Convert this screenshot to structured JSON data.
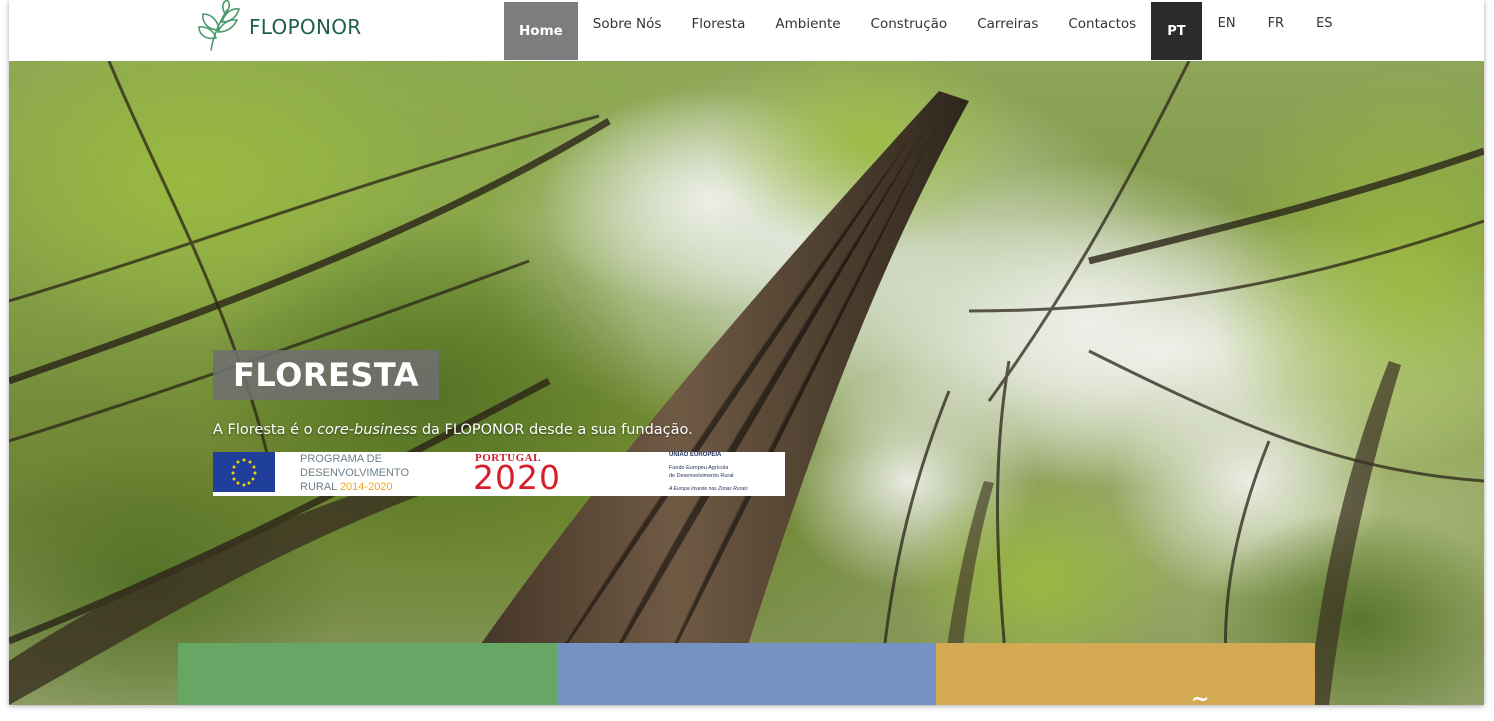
{
  "header": {
    "logo_text": "FLOPONOR",
    "nav": [
      "Home",
      "Sobre Nós",
      "Floresta",
      "Ambiente",
      "Construção",
      "Carreiras",
      "Contactos"
    ],
    "active_nav": "Home",
    "languages": [
      "PT",
      "EN",
      "FR",
      "ES"
    ],
    "active_language": "PT"
  },
  "hero": {
    "title": "FLORESTA",
    "subtitle_before": "A Floresta é o ",
    "subtitle_em": "core-business",
    "subtitle_after": " da FLOPONOR desde a sua fundação."
  },
  "funding": {
    "pdr_line1": "PROGRAMA DE",
    "pdr_line2": "DESENVOLVIMENTO",
    "pdr_line3_a": "RURAL ",
    "pdr_line3_b": "2014-2020",
    "portugal_word": "PORTUGAL",
    "portugal_year": "2020",
    "eu_title": "UNIÃO EUROPEIA",
    "eu_line1": "Fundo Europeu Agrícola",
    "eu_line2": "de Desenvolvimento Rural",
    "eu_slogan": "A Europa Investe nas Zonas Rurais"
  },
  "tiles": {
    "gold_partial": "~"
  },
  "colors": {
    "brand_green": "#1f5f4a",
    "nav_active": "#7d7d7d",
    "lang_active": "#2b2b2b",
    "tile_green": "#67a766",
    "tile_blue": "#7592c5",
    "tile_gold": "#d4a954"
  },
  "icons": {
    "logo": "leaf-sprig-icon",
    "eu": "eu-flag-icon",
    "portugal": "portugal-flag-icon",
    "pdr": "pdr2020-logo-icon"
  }
}
